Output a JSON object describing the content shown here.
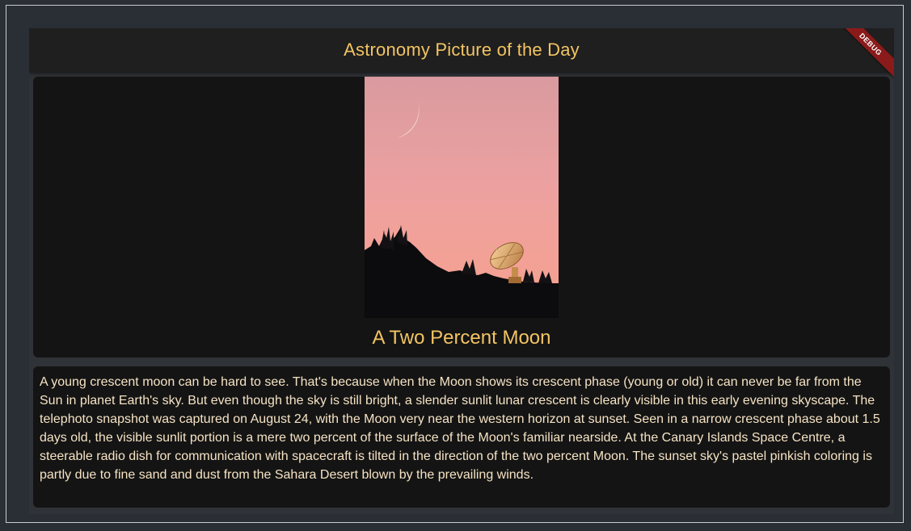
{
  "app": {
    "title": "Astronomy Picture of the Day",
    "debug_banner": "DEBUG"
  },
  "apod": {
    "image_icon": "crescent-moon-radio-dish-photo",
    "title": "A Two Percent Moon",
    "explanation": "A young crescent moon can be hard to see. That's because when the Moon shows its crescent phase (young or old) it can never be far from the Sun in planet Earth's sky. But even though the sky is still bright, a slender sunlit lunar crescent is clearly visible in this early evening skyscape. The telephoto snapshot was captured on August 24, with the Moon very near the western horizon at sunset. Seen in a narrow crescent phase about 1.5 days old, the visible sunlit portion is a mere two percent of the surface of the Moon's familiar nearside. At the Canary Islands Space Centre, a steerable radio dish for communication with spacecraft is tilted in the direction of the two percent Moon. The sunset sky's pastel pinkish coloring is partly due to fine sand and dust from the Sahara Desert blown by the prevailing winds."
  },
  "colors": {
    "accent": "#f3c463",
    "card": "#141414",
    "background": "#2f3236",
    "debug": "#8b1a1a"
  }
}
